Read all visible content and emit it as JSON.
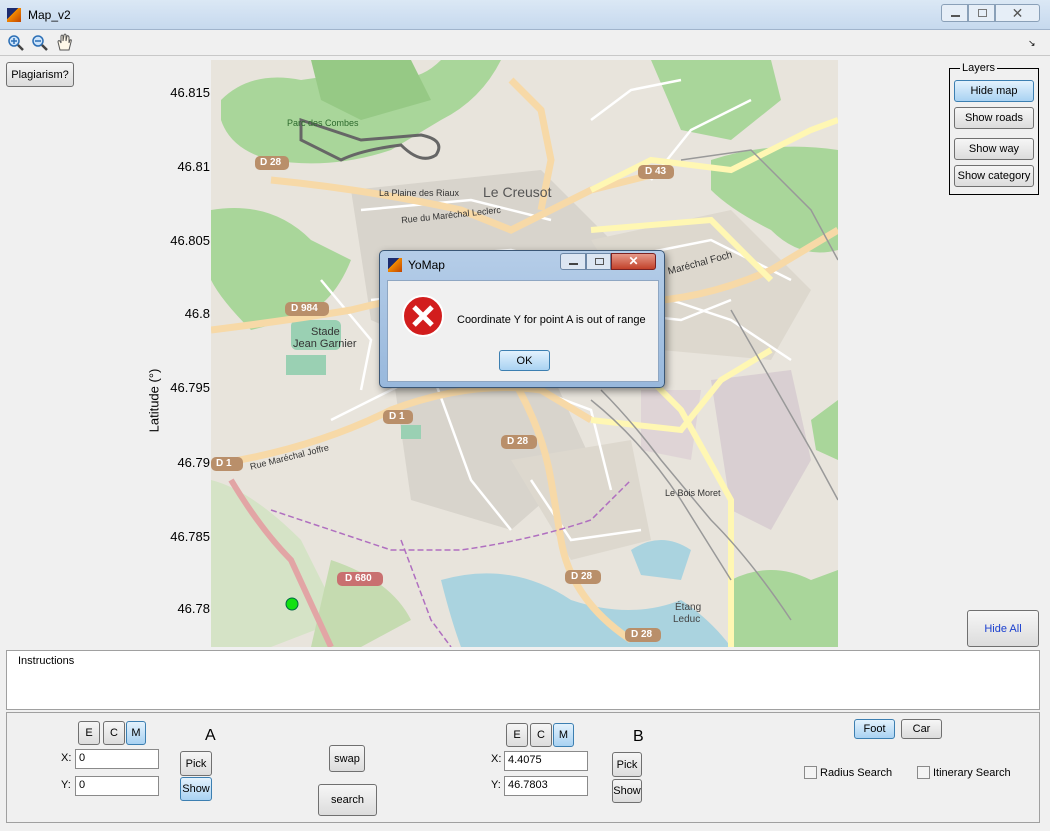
{
  "window": {
    "title": "Map_v2"
  },
  "toolbar": {
    "zoom_in": "zoom-in",
    "zoom_out": "zoom-out",
    "pan": "pan"
  },
  "plagiarism_button": "Plagiarism?",
  "axis": {
    "ylabel": "Latitude (°)",
    "ticks": [
      "46.815",
      "46.81",
      "46.805",
      "46.8",
      "46.795",
      "46.79",
      "46.785",
      "46.78"
    ]
  },
  "map_labels": {
    "park": "Parc des Combes",
    "plaine": "La Plaine des Riaux",
    "creusot": "Le Creusot",
    "leclerc": "Rue du Maréchal Leclerc",
    "foch": "Maréchal Foch",
    "stade1": "Stade",
    "stade2": "Jean Garnier",
    "joffre": "Rue Maréchal Joffre",
    "bois": "Le Bois Moret",
    "etang1": "Étang",
    "etang2": "Leduc",
    "d28a": "D 28",
    "d43": "D 43",
    "d984": "D 984",
    "d1a": "D 1",
    "d1b": "D 1",
    "d28b": "D 28",
    "d680": "D 680",
    "d28c": "D 28",
    "d28d": "D 28"
  },
  "layers": {
    "title": "Layers",
    "hide_map": "Hide map",
    "show_roads": "Show roads",
    "show_way": "Show way",
    "show_category": "Show category"
  },
  "hide_all": "Hide All",
  "instructions": {
    "title": "Instructions"
  },
  "point_a": {
    "label": "A",
    "mode_e": "E",
    "mode_c": "C",
    "mode_m": "M",
    "x_label": "X:",
    "y_label": "Y:",
    "x_value": "0",
    "y_value": "0",
    "pick": "Pick",
    "show": "Show"
  },
  "point_b": {
    "label": "B",
    "mode_e": "E",
    "mode_c": "C",
    "mode_m": "M",
    "x_label": "X:",
    "y_label": "Y:",
    "x_value": "4.4075",
    "y_value": "46.7803",
    "pick": "Pick",
    "show": "Show"
  },
  "swap": "swap",
  "search": "search",
  "transport": {
    "foot": "Foot",
    "car": "Car"
  },
  "options": {
    "radius": "Radius Search",
    "itinerary": "Itinerary Search"
  },
  "dialog": {
    "title": "YoMap",
    "message": "Coordinate Y for point A is out of range",
    "ok": "OK"
  }
}
